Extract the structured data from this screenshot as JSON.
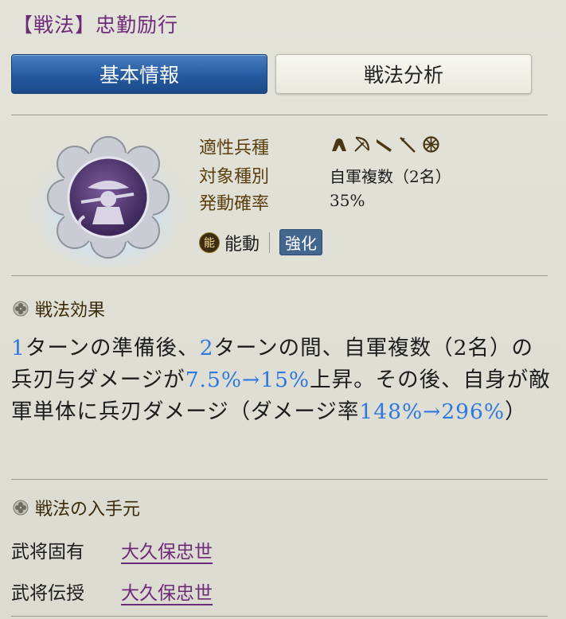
{
  "title": "【戦法】忠勤励行",
  "tabs": [
    {
      "label": "基本情報",
      "active": true
    },
    {
      "label": "戦法分析",
      "active": false
    }
  ],
  "skill_icon": "ninja-skill-icon",
  "meta": {
    "troop_label": "適性兵種",
    "troop_icons": [
      "cavalry-icon",
      "bow-icon",
      "gun-icon",
      "spear-icon",
      "wheel-icon"
    ],
    "target_label": "対象種別",
    "target_value": "自軍複数（2名）",
    "rate_label": "発動確率",
    "rate_value": "35%"
  },
  "tags": {
    "circle_text": "能",
    "type": "能動",
    "box": "強化"
  },
  "effect": {
    "heading": "戦法効果",
    "text": {
      "p1": "1",
      "p2": "ターンの準備後、",
      "p3": "2",
      "p4": "ターンの間、自軍複数（2名）の兵刃与ダメージが",
      "p5": "7.5%→15%",
      "p6": "上昇。その後、自身が敵軍単体に兵刃ダメージ（ダメージ率",
      "p7": "148%→296%",
      "p8": "）"
    }
  },
  "source": {
    "heading": "戦法の入手元",
    "rows": [
      {
        "label": "武将固有",
        "value": "大久保忠世"
      },
      {
        "label": "武将伝授",
        "value": "大久保忠世"
      }
    ]
  },
  "colors": {
    "title": "#6d2a78",
    "highlight": "#2f78e0",
    "tab_active": "#245aa0"
  }
}
